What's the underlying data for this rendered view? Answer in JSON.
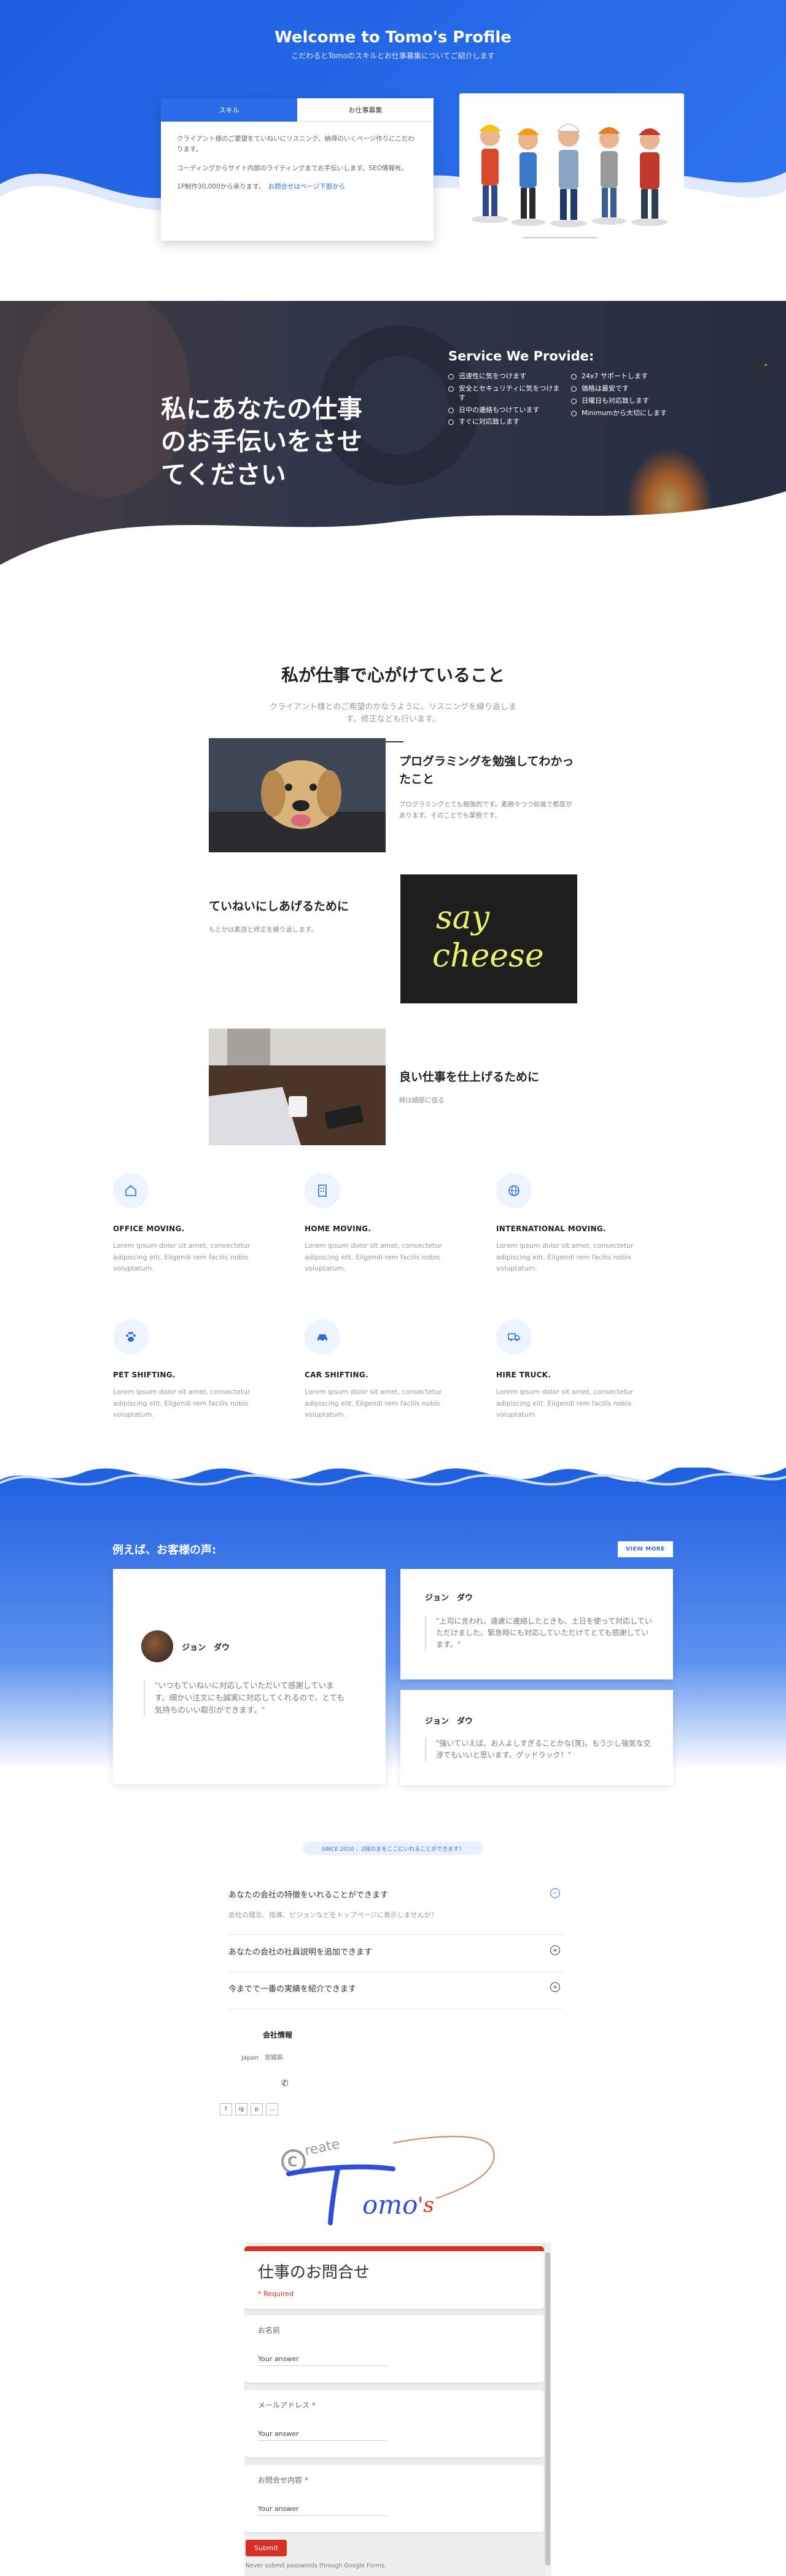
{
  "hero": {
    "title": "Welcome to Tomo's Profile",
    "subtitle": "こだわるとTomoのスキルとお仕事募集についてご紹介します",
    "tabs": [
      {
        "label": "スキル",
        "active": true
      },
      {
        "label": "お仕事募集",
        "active": false
      }
    ],
    "tab_paragraphs": [
      "クライアント様のご要望をていねいにリスニング、納得のいくページ作りにこだわります。",
      "コーディングからサイト内部のライティングまでお手伝いします。SEO情報有。",
      "1P制作30,000から承ります。"
    ],
    "tab_link": "お問合せはページ下部から"
  },
  "service": {
    "headline_lines": [
      "私にあなたの仕事",
      "のお手伝いをさせ",
      "てください"
    ],
    "title": "Service We Provide:",
    "left_items": [
      "迅速性に気をつけます",
      "安全とセキュリティに気をつけます",
      "日中の連絡もつけています",
      "すぐに対応致します"
    ],
    "right_items": [
      "24x7 サポートします",
      "価格は最安です",
      "日曜日も対応致します",
      "Minimumから大切にします"
    ],
    "up_icon": "chevron-up-icon"
  },
  "principles": {
    "title": "私が仕事で心がけていること",
    "subtitle": "クライアント様とのご希望のかなうように、リスニングを繰り返します。修正なども行います。",
    "features": [
      {
        "heading": "プログラミングを勉強してわかったこと",
        "text": "プログラミングとても勉強的です。素敵々つつ前進で都度があります。そのことでも業務です。",
        "image": "dog-photo"
      },
      {
        "heading": "ていねいにしあげるために",
        "text": "もとかは素語と修正を繰り返します。",
        "image": "neon-say-cheese"
      },
      {
        "heading": "良い仕事を仕上げるために",
        "text": "締は細部に宿る",
        "image": "laptop-desk-photo"
      }
    ],
    "neon_text": [
      "say",
      "cheese"
    ]
  },
  "services_grid": [
    {
      "icon": "home-icon",
      "title": "OFFICE MOVING.",
      "text": "Lorem ipsum dolor sit amet, consectetur adipiscing elit. Eligendi rem facilis nobis voluptatum."
    },
    {
      "icon": "building-icon",
      "title": "HOME MOVING.",
      "text": "Lorem ipsum dolor sit amet, consectetur adipiscing elit. Eligendi rem facilis nobis voluptatum."
    },
    {
      "icon": "globe-icon",
      "title": "INTERNATIONAL MOVING.",
      "text": "Lorem ipsum dolor sit amet, consectetur adipiscing elit. Eligendi rem facilis nobis voluptatum."
    },
    {
      "icon": "paw-icon",
      "title": "PET SHIFTING.",
      "text": "Lorem ipsum dolor sit amet, consectetur adipiscing elit. Eligendi rem facilis nobis voluptatum."
    },
    {
      "icon": "car-icon",
      "title": "CAR SHIFTING.",
      "text": "Lorem ipsum dolor sit amet, consectetur adipiscing elit. Eligendi rem facilis nobis voluptatum."
    },
    {
      "icon": "truck-icon",
      "title": "HIRE TRUCK.",
      "text": "Lorem ipsum dolor sit amet, consectetur adipiscing elit. Eligendi rem facilis nobis voluptatum."
    }
  ],
  "testimonials": {
    "title": "例えば、お客様の声:",
    "view_more": "VIEW MORE",
    "items": [
      {
        "name": "ジョン　ダウ",
        "quote": "\"いつもていねいに対応していただいて感謝しています。細かい注文にも誠実に対応してくれるので、とても気持ちのいい取引ができます。\""
      },
      {
        "name": "ジョン　ダウ",
        "quote": "\"上司に言われ、遠慮に連絡したときも、土日を使って対応していただけました。緊急時にも対応していただけてとても感謝しています。\""
      },
      {
        "name": "ジョン　ダウ",
        "quote": "\"強いていえば、お人よしすぎることかな(笑)。もう少し強気な交渉でもいいと思います。グッドラック！\""
      }
    ]
  },
  "faq": {
    "badge": "SINCE 2010 、2段のまをここにいれることができます！",
    "items": [
      {
        "q": "あなたの会社の特徴をいれることができます",
        "a": "会社の理念、指導、ビジョンなどをトップページに表示しませんか？",
        "icon": "minus-circle-icon"
      },
      {
        "q": "あなたの会社の社員説明を追加できます",
        "a": "",
        "icon": "plus-circle-icon"
      },
      {
        "q": "今までで一番の実績を紹介できます",
        "a": "",
        "icon": "plus-circle-icon"
      }
    ]
  },
  "company": {
    "title": "会社情報",
    "address": "Japan　宮城県",
    "phone_icon": "phone-icon",
    "social": [
      "f",
      "ig",
      "p",
      "..."
    ]
  },
  "signature": {
    "lettering": "Create Tomo's"
  },
  "form": {
    "title": "仕事のお問合せ",
    "required": "* Required",
    "questions": [
      {
        "label": "お名前",
        "answer": "Your answer"
      },
      {
        "label": "メールアドレス *",
        "answer": "Your answer"
      },
      {
        "label": "お問合せ内容 *",
        "answer": "Your answer"
      }
    ],
    "submit": "Submit",
    "never": "Never submit passwords through Google Forms."
  },
  "colors": {
    "primary": "#2b6de8",
    "form_red": "#d93025"
  }
}
